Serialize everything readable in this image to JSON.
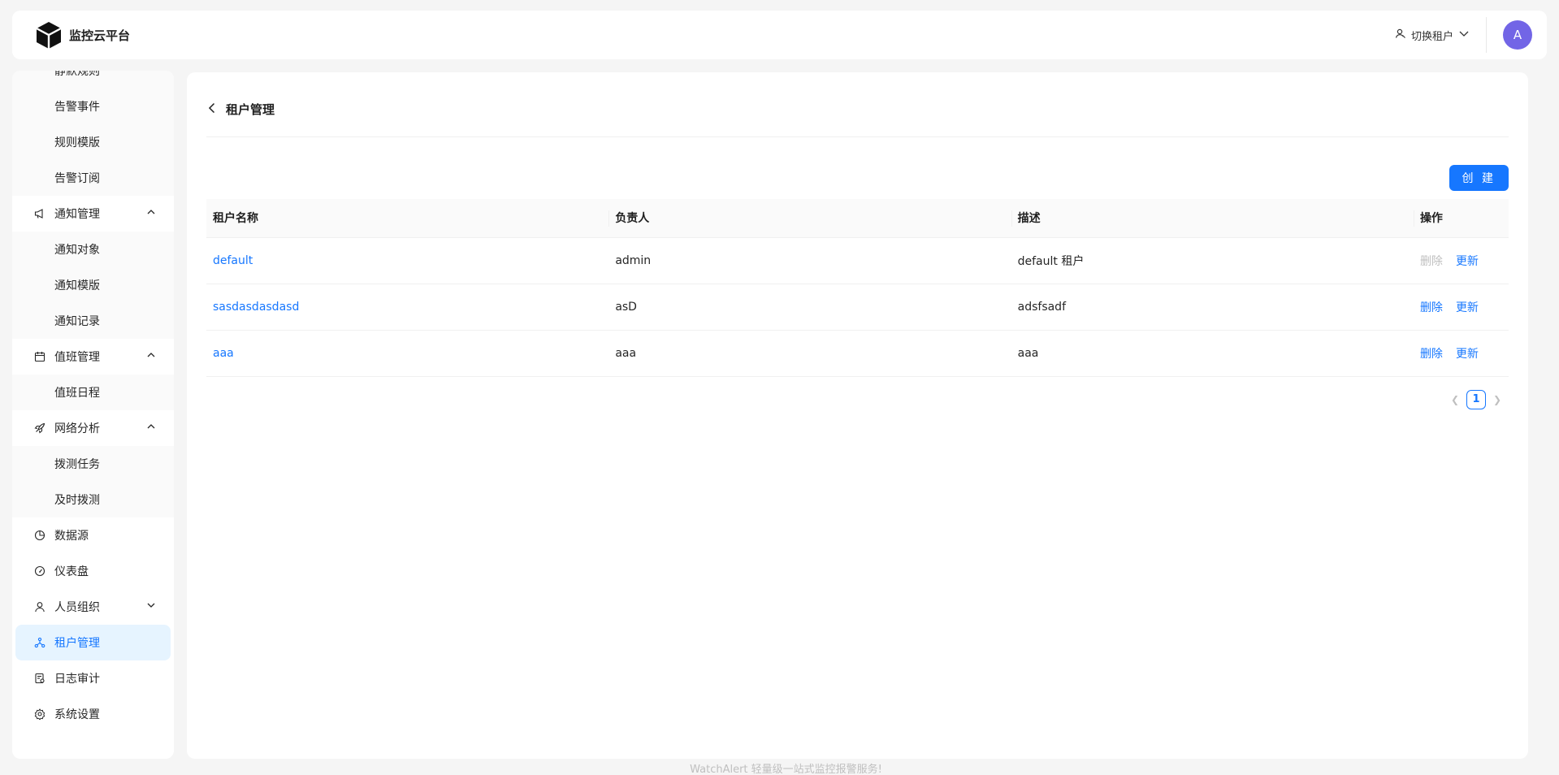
{
  "header": {
    "app_name": "监控云平台",
    "tenant_switch_label": "切换租户",
    "avatar_letter": "A"
  },
  "sidebar": {
    "alert_subitems": [
      "静默规则",
      "告警事件",
      "规则模版",
      "告警订阅"
    ],
    "notify": {
      "label": "通知管理",
      "subitems": [
        "通知对象",
        "通知模版",
        "通知记录"
      ]
    },
    "duty": {
      "label": "值班管理",
      "subitems": [
        "值班日程"
      ]
    },
    "network": {
      "label": "网络分析",
      "subitems": [
        "拨测任务",
        "及时拨测"
      ]
    },
    "items": {
      "datasource": "数据源",
      "dashboard": "仪表盘",
      "people": "人员组织",
      "tenant": "租户管理",
      "audit": "日志审计",
      "settings": "系统设置"
    }
  },
  "page": {
    "title": "租户管理",
    "create_label": "创 建"
  },
  "table": {
    "columns": [
      "租户名称",
      "负责人",
      "描述",
      "操作"
    ],
    "rows": [
      {
        "name": "default",
        "owner": "admin",
        "desc": "default 租户",
        "delete": "删除",
        "update": "更新",
        "delete_disabled": true
      },
      {
        "name": "sasdasdasdasd",
        "owner": "asD",
        "desc": "adsfsadf",
        "delete": "删除",
        "update": "更新",
        "delete_disabled": false
      },
      {
        "name": "aaa",
        "owner": "aaa",
        "desc": "aaa",
        "delete": "删除",
        "update": "更新",
        "delete_disabled": false
      }
    ]
  },
  "pagination": {
    "current": "1"
  },
  "footer": "WatchAlert 轻量级一站式监控报警服务!",
  "colors": {
    "primary": "#1677ff",
    "avatar": "#7265e6",
    "active_bg": "#e6f4ff"
  }
}
